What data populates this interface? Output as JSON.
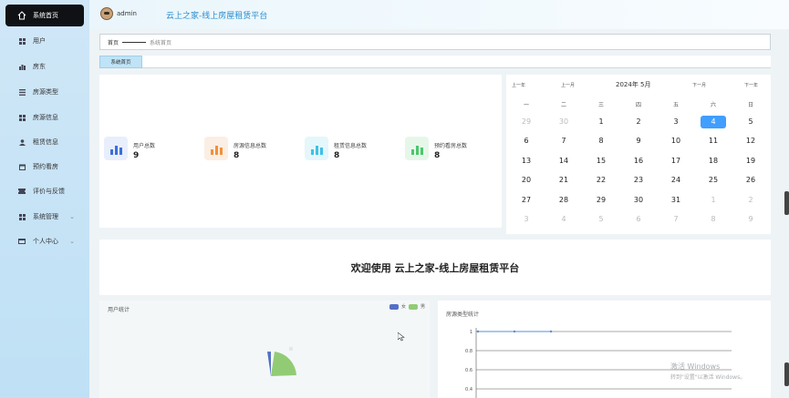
{
  "sidebar": {
    "items": [
      {
        "label": "系统首页",
        "icon": "home-icon",
        "active": true
      },
      {
        "label": "用户",
        "icon": "grid-icon"
      },
      {
        "label": "房东",
        "icon": "bar-icon"
      },
      {
        "label": "房源类型",
        "icon": "list-icon"
      },
      {
        "label": "房源信息",
        "icon": "grid-icon"
      },
      {
        "label": "租赁信息",
        "icon": "person-icon"
      },
      {
        "label": "预约看房",
        "icon": "calendar-icon"
      },
      {
        "label": "评价与反馈",
        "icon": "ticket-icon"
      },
      {
        "label": "系统管理",
        "icon": "grid-icon",
        "expandable": true
      },
      {
        "label": "个人中心",
        "icon": "card-icon",
        "expandable": true
      }
    ]
  },
  "header": {
    "user": "admin",
    "title": "云上之家-线上房屋租赁平台"
  },
  "breadcrumb": {
    "home": "首页",
    "current": "系统首页"
  },
  "tab": {
    "label": "系统首页"
  },
  "stats": [
    {
      "label": "用户总数",
      "value": "9",
      "bg": "#e8eefb",
      "bar": "#3b6fd9"
    },
    {
      "label": "房源信息总数",
      "value": "8",
      "bg": "#fbeee4",
      "bar": "#f0913b"
    },
    {
      "label": "租赁信息总数",
      "value": "8",
      "bg": "#e4f7fb",
      "bar": "#3ec1e6"
    },
    {
      "label": "预约看房总数",
      "value": "8",
      "bg": "#e6f7ea",
      "bar": "#4cc76a"
    }
  ],
  "calendar": {
    "prev_year": "上一年",
    "prev_month": "上一月",
    "month_label": "2024年 5月",
    "next_month": "下一月",
    "next_year": "下一年",
    "weekdays": [
      "一",
      "二",
      "三",
      "四",
      "五",
      "六",
      "日"
    ],
    "weeks": [
      [
        "29",
        "30",
        "1",
        "2",
        "3",
        "4",
        "5"
      ],
      [
        "6",
        "7",
        "8",
        "9",
        "10",
        "11",
        "12"
      ],
      [
        "13",
        "14",
        "15",
        "16",
        "17",
        "18",
        "19"
      ],
      [
        "20",
        "21",
        "22",
        "23",
        "24",
        "25",
        "26"
      ],
      [
        "27",
        "28",
        "29",
        "30",
        "31",
        "1",
        "2"
      ],
      [
        "3",
        "4",
        "5",
        "6",
        "7",
        "8",
        "9"
      ]
    ],
    "selected": "4"
  },
  "welcome": {
    "text": "欢迎使用 云上之家-线上房屋租赁平台"
  },
  "user_chart": {
    "title": "用户统计",
    "legend": [
      {
        "name": "女",
        "color": "#5470c6"
      },
      {
        "name": "男",
        "color": "#91cc75"
      }
    ]
  },
  "chart_data": {
    "type": "line",
    "title": "房源类型统计",
    "y_ticks": [
      "1",
      "0.8",
      "0.6",
      "0.4"
    ],
    "ylim": [
      0.4,
      1
    ],
    "series": [
      {
        "values": [
          1,
          1,
          1
        ]
      }
    ]
  },
  "watermark": {
    "line1": "激活 Windows",
    "line2": "转到\"设置\"以激活 Windows。"
  }
}
